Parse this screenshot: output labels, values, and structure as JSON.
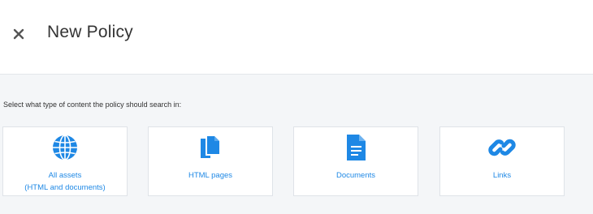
{
  "header": {
    "close_icon": "close-icon",
    "title": "New Policy"
  },
  "content": {
    "prompt": "Select what type of content the policy should search in:"
  },
  "options": [
    {
      "icon": "globe-icon",
      "label_line1": "All assets",
      "label_line2": "(HTML and documents)"
    },
    {
      "icon": "copy-pages-icon",
      "label_line1": "HTML pages"
    },
    {
      "icon": "document-icon",
      "label_line1": "Documents"
    },
    {
      "icon": "link-icon",
      "label_line1": "Links"
    }
  ],
  "colors": {
    "accent": "#1e88e5",
    "background": "#f4f6f8",
    "card": "#ffffff"
  }
}
